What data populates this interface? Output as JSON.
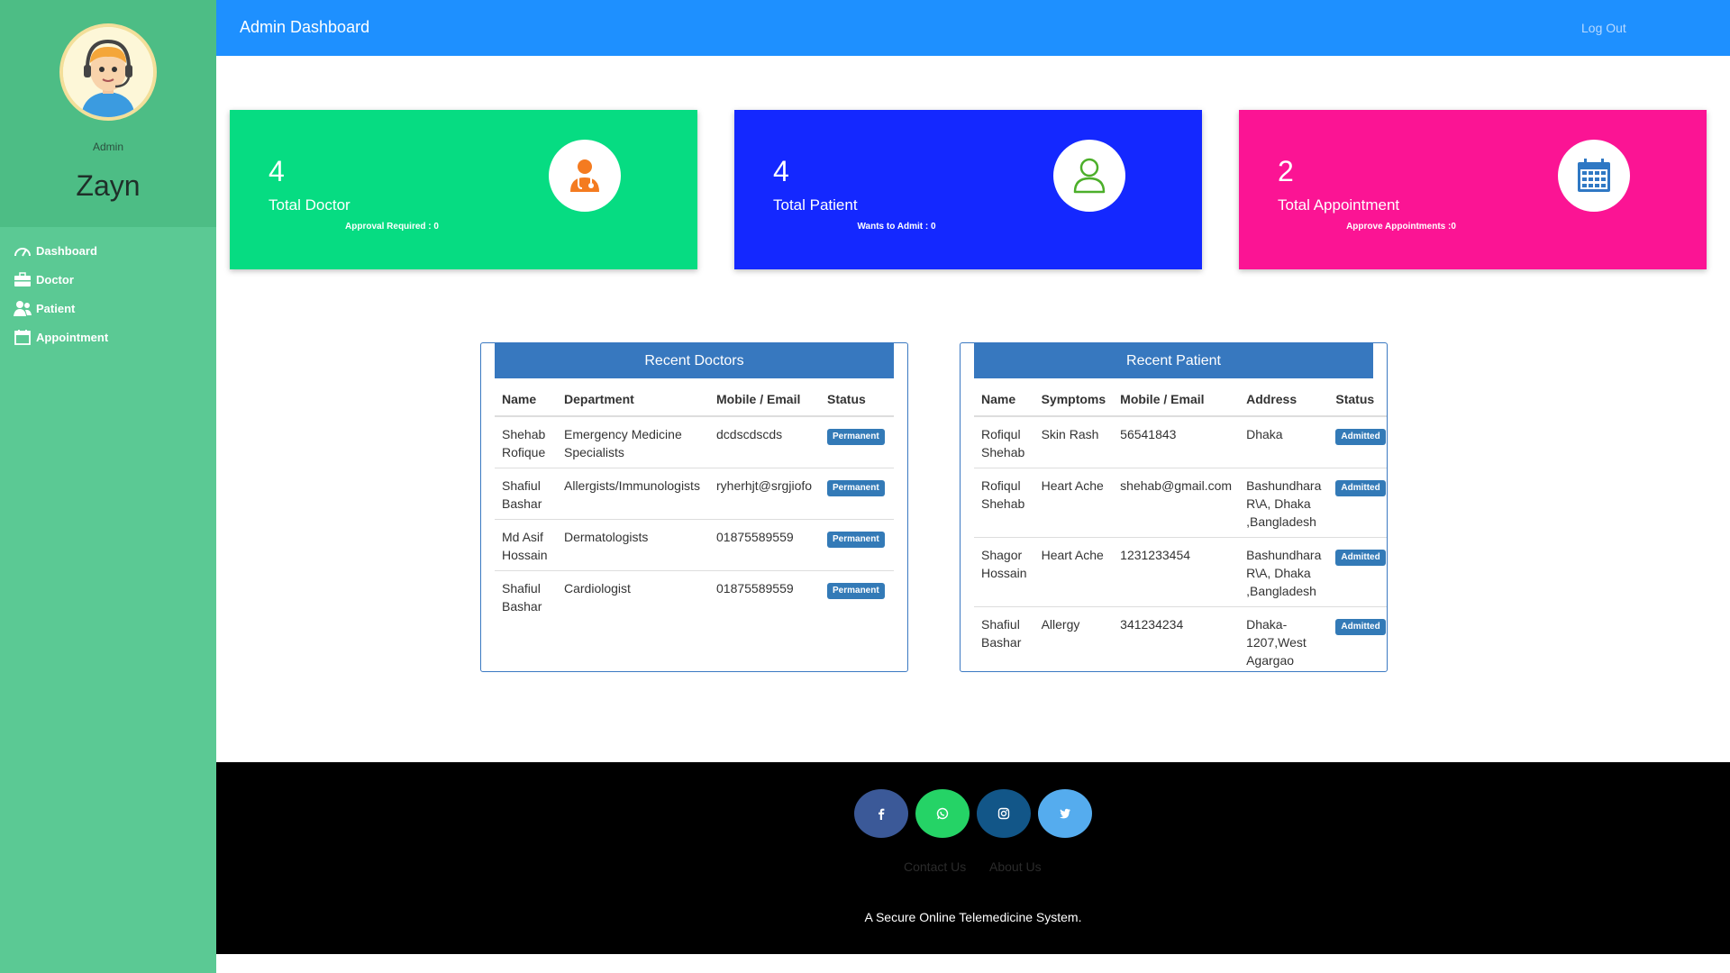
{
  "sidebar": {
    "role": "Admin",
    "name": "Zayn",
    "items": [
      {
        "label": "Dashboard",
        "icon": "gauge-icon"
      },
      {
        "label": "Doctor",
        "icon": "briefcase-icon"
      },
      {
        "label": "Patient",
        "icon": "users-icon"
      },
      {
        "label": "Appointment",
        "icon": "calendar-icon"
      }
    ]
  },
  "header": {
    "title": "Admin Dashboard",
    "logout": "Log Out"
  },
  "cards": [
    {
      "count": "4",
      "label": "Total Doctor",
      "sub": "Approval Required : 0",
      "color": "#06dc82",
      "icon": "doctor-icon"
    },
    {
      "count": "4",
      "label": "Total Patient",
      "sub": "Wants to Admit : 0",
      "color": "#1428ff",
      "icon": "user-icon"
    },
    {
      "count": "2",
      "label": "Total Appointment",
      "sub": "Approve Appointments :0",
      "color": "#fb1494",
      "icon": "calendar-icon"
    }
  ],
  "recent_doctors": {
    "title": "Recent Doctors",
    "columns": [
      "Name",
      "Department",
      "Mobile / Email",
      "Status"
    ],
    "rows": [
      [
        "Shehab Rofique",
        "Emergency Medicine Specialists",
        "dcdscdscds",
        "Permanent"
      ],
      [
        "Shafiul Bashar",
        "Allergists/Immunologists",
        "ryherhjt@srgjiofo",
        "Permanent"
      ],
      [
        "Md Asif Hossain",
        "Dermatologists",
        "01875589559",
        "Permanent"
      ],
      [
        "Shafiul Bashar",
        "Cardiologist",
        "01875589559",
        "Permanent"
      ]
    ]
  },
  "recent_patients": {
    "title": "Recent Patient",
    "columns": [
      "Name",
      "Symptoms",
      "Mobile / Email",
      "Address",
      "Status"
    ],
    "rows": [
      [
        "Rofiqul Shehab",
        "Skin Rash",
        "56541843",
        "Dhaka",
        "Admitted"
      ],
      [
        "Rofiqul Shehab",
        "Heart Ache",
        "shehab@gmail.com",
        "Bashundhara R\\A, Dhaka ,Bangladesh",
        "Admitted"
      ],
      [
        "Shagor Hossain",
        "Heart Ache",
        "1231233454",
        "Bashundhara R\\A, Dhaka ,Bangladesh",
        "Admitted"
      ],
      [
        "Shafiul Bashar",
        "Allergy",
        "341234234",
        "Dhaka-1207,West Agargao",
        "Admitted"
      ]
    ]
  },
  "footer": {
    "social": [
      "facebook-icon",
      "whatsapp-icon",
      "instagram-icon",
      "twitter-icon"
    ],
    "contact": "Contact Us",
    "about": "About Us",
    "tagline": "A Secure Online Telemedicine System."
  },
  "colors": {
    "sidebar": "#5bc994",
    "header": "#1e90ff",
    "doctor_card": "#06dc82",
    "patient_card": "#1428ff",
    "appointment_card": "#fb1494",
    "table_head": "#3778bf"
  }
}
